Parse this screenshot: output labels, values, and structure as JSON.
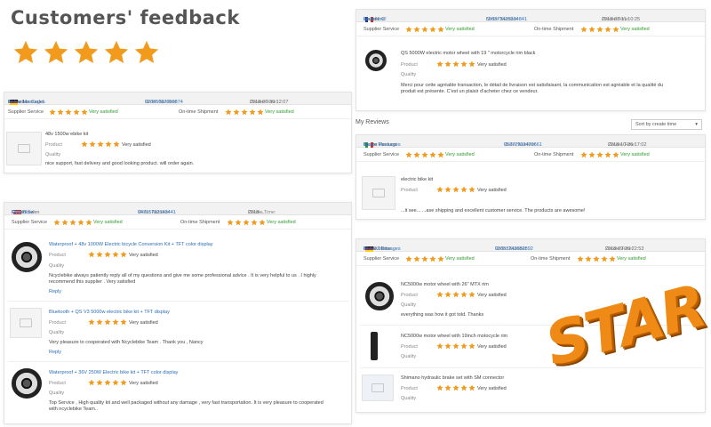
{
  "title": "Customers' feedback",
  "colors": {
    "star": "#f29a1b",
    "accent": "#2a6ebb",
    "satisfied": "#2f9a2f",
    "stamp": "#f08a16"
  },
  "labels": {
    "buyer": "Buyer:",
    "order": "Order Number:",
    "create": "Create Time:",
    "supplier": "Supplier Service",
    "shipment": "On-time Shipment",
    "satisfied": "Very satisfied",
    "product": "Product",
    "quality": "Quality",
    "reply": "Reply"
  },
  "star_overlay": "STAR",
  "my_reviews": "My Reviews",
  "sort_by": "Sort by create time",
  "reviews": {
    "r1": {
      "buyer": "Laurent C",
      "action": "Chat Now!",
      "order": "506373425234841",
      "time": "2018-08-11 10:25",
      "item": "QS 5000W electric motor wheel with 19 \" motorcycle rim black",
      "comment1": "Merci pour cette agréable transaction, le détail de livraison est satisfaisant, la communication est agréable et la qualité du",
      "comment2": "produit est présente. C'est un plaisir d'acheter chez ce vendeur."
    },
    "r2": {
      "buyer": "Sebastian Cedel",
      "action": "Leave Messages",
      "order": "92085087099874",
      "time": "2018-06-30 12:07",
      "item": "48v 1500w ebike kit",
      "comment": "nice support, fast delivery and good looking product. will order again."
    },
    "r3": {
      "buyer": "Marco Paolucci",
      "action": "Leave Messages",
      "order": "95272903479661",
      "time": "2018-10-26 17:02",
      "item": "electric bike kit",
      "comment": "...it see... ...ase shipping and excellent customer service. The products are awesome!"
    },
    "r4": {
      "buyer": "Harold Swen",
      "action": "Chat Now!",
      "order": "94715792143441",
      "time": "2018-...",
      "item1": "Waterproof + 48v 1000W Electric bicycle Conversion Kit + TFT color display",
      "comment1a": "Ncyclebike always patiently reply all of my questions and give me some professional advice . It is very helpful to us . I highly",
      "comment1b": "recommend this supplier . Very satisfied",
      "item2": "Bluetooth + QS V3 5000w electric bike kit + TFT display",
      "comment2": "Very pleasure to cooperated with Ncyclebike Team . Thank you , Nancy",
      "item3": "Waterproof + 36V 250W Electric bike kit + TFT color display",
      "comment3a": "Top Service ,  High quality kit and well packaged without any damage , very fast transportation. It is very pleasure to cooperated",
      "comment3b": "with ncyclebike Team.."
    },
    "r5": {
      "buyer": "FEDDZ Bike",
      "action": "Leave Messages",
      "order": "93653243682892",
      "time": "2018-09-20 22:53",
      "item1": "NC5000w motor wheel with 26\" MTX rim",
      "comment1": "everything was how it got told. Thanks",
      "item2": "NC5000w motor wheel with 19inch motocycle rim",
      "item3": "Shimano hydraulic brake set with SM connector"
    }
  }
}
